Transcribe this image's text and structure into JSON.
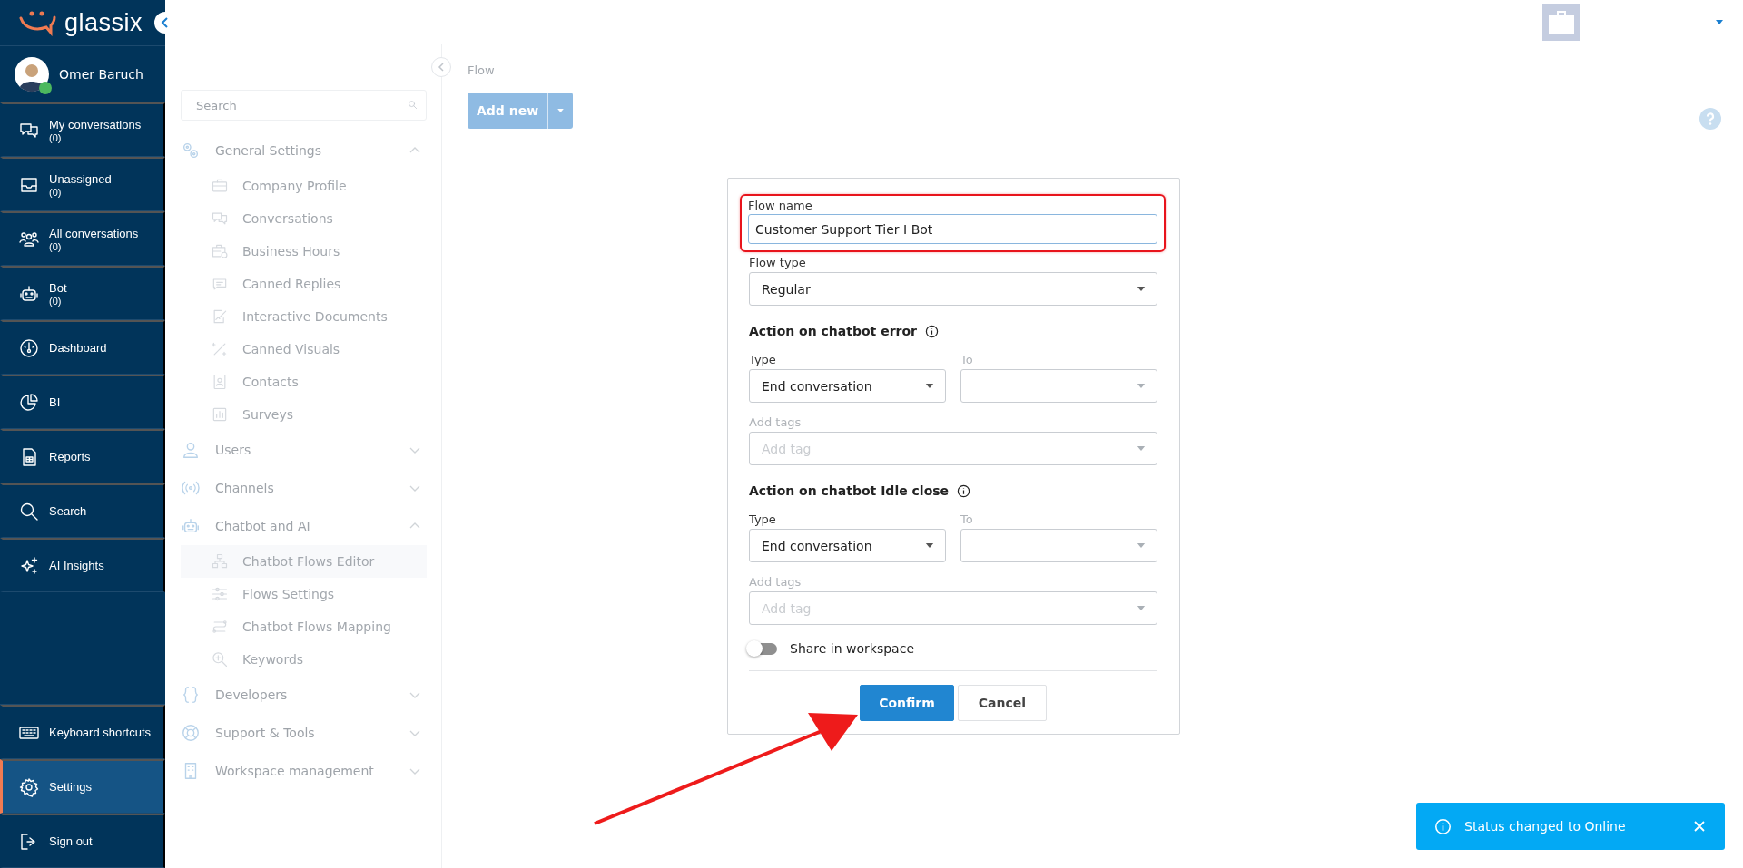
{
  "logo": {
    "text": "glassix"
  },
  "user": {
    "name": "Omer Baruch",
    "online": true
  },
  "nav": [
    {
      "label": "My conversations",
      "count": "(0)",
      "selected": false
    },
    {
      "label": "Unassigned",
      "count": "(0)",
      "selected": false
    },
    {
      "label": "All conversations",
      "count": "(0)",
      "selected": false
    },
    {
      "label": "Bot",
      "count": "(0)",
      "selected": false
    },
    {
      "label": "Dashboard",
      "selected": false
    },
    {
      "label": "BI",
      "selected": false
    },
    {
      "label": "Reports",
      "selected": false
    },
    {
      "label": "Search",
      "selected": false
    },
    {
      "label": "AI Insights",
      "selected": false
    }
  ],
  "bottom_nav": [
    {
      "label": "Keyboard shortcuts",
      "selected": false
    },
    {
      "label": "Settings",
      "selected": true
    },
    {
      "label": "Sign out",
      "selected": false
    }
  ],
  "settings_menu": {
    "search_placeholder": "Search",
    "groups": [
      {
        "label": "General Settings",
        "expanded": true,
        "children": [
          {
            "label": "Company Profile",
            "selected": false
          },
          {
            "label": "Conversations",
            "selected": false
          },
          {
            "label": "Business Hours",
            "selected": false
          },
          {
            "label": "Canned Replies",
            "selected": false
          },
          {
            "label": "Interactive Documents",
            "selected": false
          },
          {
            "label": "Canned Visuals",
            "selected": false
          },
          {
            "label": "Contacts",
            "selected": false
          },
          {
            "label": "Surveys",
            "selected": false
          }
        ]
      },
      {
        "label": "Users",
        "expanded": false
      },
      {
        "label": "Channels",
        "expanded": false
      },
      {
        "label": "Chatbot and AI",
        "expanded": true,
        "children": [
          {
            "label": "Chatbot Flows Editor",
            "selected": true
          },
          {
            "label": "Flows Settings",
            "selected": false
          },
          {
            "label": "Chatbot Flows Mapping",
            "selected": false
          },
          {
            "label": "Keywords",
            "selected": false
          }
        ]
      },
      {
        "label": "Developers",
        "expanded": false
      },
      {
        "label": "Support & Tools",
        "expanded": false
      },
      {
        "label": "Workspace management",
        "expanded": false
      }
    ]
  },
  "breadcrumb": "Flow",
  "add_button": "Add new",
  "modal": {
    "flow_name": {
      "label": "Flow name",
      "value": "Customer Support Tier I Bot",
      "highlighted": true
    },
    "flow_type": {
      "label": "Flow type",
      "value": "Regular"
    },
    "sections": [
      {
        "title": "Action on chatbot error",
        "type_label": "Type",
        "type_value": "End conversation",
        "to_label": "To",
        "tags_label": "Add tags",
        "tags_placeholder": "Add tag"
      },
      {
        "title": "Action on chatbot Idle close",
        "type_label": "Type",
        "type_value": "End conversation",
        "to_label": "To",
        "tags_label": "Add tags",
        "tags_placeholder": "Add tag"
      }
    ],
    "share": {
      "label": "Share in workspace",
      "on": false
    },
    "buttons": [
      "Confirm",
      "Cancel"
    ]
  },
  "toast": {
    "text": "Status changed to Online"
  }
}
